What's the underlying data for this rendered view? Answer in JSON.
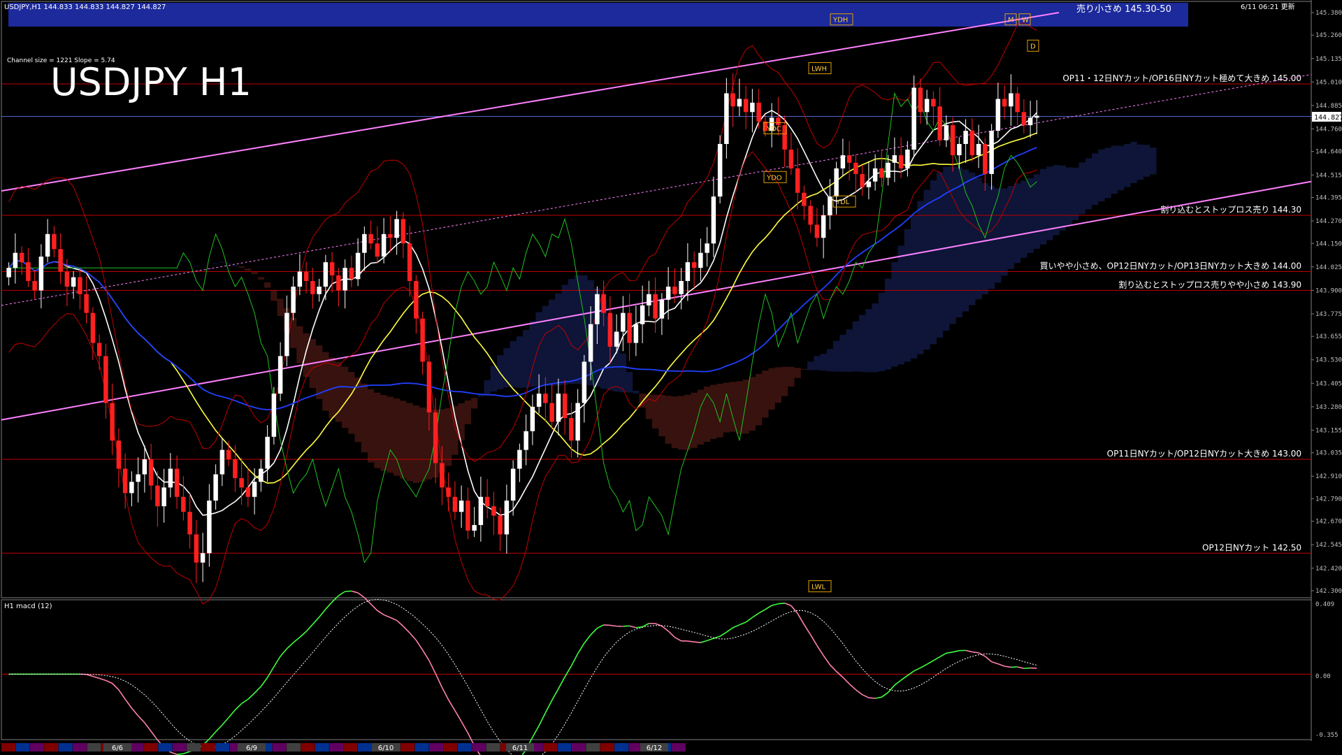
{
  "header": {
    "symbol_info": "USDJPY,H1  144.833 144.833 144.827 144.827",
    "server_time": "6/11 06:21 更新",
    "channel_info": "Channel size = 1221 Slope = 5.74",
    "big_title": "USDJPY H1",
    "top_banner": "売り小さめ 145.30-50"
  },
  "colors": {
    "background": "#000000",
    "bull_candle": "#ffffff",
    "bear_candle": "#ff2020",
    "channel": "#ff80ff",
    "grid_label": "#c0c0c0",
    "level_line": "#c00000",
    "banner": "#1c2a9c",
    "macd_up": "#40ff40",
    "macd_down": "#ff80b0",
    "cloud_up": "#4060ff",
    "cloud_down": "#ff5040"
  },
  "chart_data": {
    "type": "line",
    "ylim": [
      142.3,
      145.38
    ],
    "yticks": [
      "145.380",
      "145.260",
      "145.135",
      "145.010",
      "144.885",
      "144.760",
      "144.640",
      "144.515",
      "144.395",
      "144.270",
      "144.150",
      "144.025",
      "143.900",
      "143.775",
      "143.655",
      "143.530",
      "143.405",
      "143.280",
      "143.155",
      "143.035",
      "142.910",
      "142.790",
      "142.670",
      "142.545",
      "142.420",
      "142.300"
    ],
    "current_price": "144.827",
    "x_dates": [
      "6/6",
      "6/9",
      "6/10",
      "6/11",
      "6/12"
    ],
    "levels": [
      {
        "price": 145.0,
        "label": "OP11・12日NYカット/OP16日NYカット極めて大きめ 145.00"
      },
      {
        "price": 144.3,
        "label": "割り込むとストップロス売り 144.30"
      },
      {
        "price": 144.0,
        "label": "買いやや小さめ、OP12日NYカット/OP13日NYカット大きめ 144.00"
      },
      {
        "price": 143.9,
        "label": "割り込むとストップロス売りやや小さめ 143.90"
      },
      {
        "price": 143.0,
        "label": "OP11日NYカット/OP12日NYカット大きめ 143.00"
      },
      {
        "price": 142.5,
        "label": "OP12日NYカット 142.50"
      }
    ],
    "markers": [
      "YDH",
      "YDC",
      "YDO",
      "YDL",
      "LWH",
      "LWL",
      "M",
      "W",
      "D"
    ],
    "close": [
      144.02,
      144.1,
      144.05,
      143.95,
      143.9,
      144.08,
      144.2,
      144.12,
      144.0,
      143.92,
      143.97,
      143.88,
      143.78,
      143.62,
      143.55,
      143.3,
      143.1,
      142.95,
      142.82,
      142.88,
      142.92,
      143.0,
      142.86,
      142.75,
      142.85,
      142.95,
      142.8,
      142.72,
      142.6,
      142.45,
      142.5,
      142.78,
      142.92,
      143.05,
      143.0,
      142.9,
      142.85,
      142.8,
      142.88,
      142.95,
      143.12,
      143.35,
      143.55,
      143.78,
      143.92,
      144.0,
      143.95,
      143.88,
      143.92,
      144.05,
      143.98,
      143.9,
      144.02,
      143.96,
      144.1,
      144.2,
      144.15,
      144.08,
      144.2,
      144.18,
      144.28,
      144.15,
      143.95,
      143.75,
      143.52,
      143.25,
      142.98,
      142.85,
      142.8,
      142.72,
      142.78,
      142.62,
      142.65,
      142.8,
      142.75,
      142.7,
      142.6,
      142.78,
      142.95,
      143.05,
      143.15,
      143.28,
      143.35,
      143.3,
      143.2,
      143.35,
      143.22,
      143.1,
      143.3,
      143.52,
      143.72,
      143.88,
      143.78,
      143.6,
      143.68,
      143.78,
      143.62,
      143.72,
      143.82,
      143.88,
      143.75,
      143.85,
      143.92,
      143.88,
      143.95,
      144.05,
      144.02,
      144.1,
      144.15,
      144.4,
      144.68,
      144.95,
      144.88,
      144.92,
      144.85,
      144.9,
      144.8,
      144.75,
      144.82,
      144.78,
      144.65,
      144.55,
      144.42,
      144.35,
      144.25,
      144.18,
      144.3,
      144.4,
      144.55,
      144.62,
      144.58,
      144.52,
      144.45,
      144.48,
      144.55,
      144.5,
      144.58,
      144.62,
      144.55,
      144.65,
      144.98,
      144.85,
      144.92,
      144.88,
      144.7,
      144.78,
      144.62,
      144.68,
      144.75,
      144.62,
      144.68,
      144.52,
      144.75,
      144.92,
      144.88,
      144.95,
      144.85,
      144.78,
      144.82,
      144.83
    ]
  },
  "macd": {
    "label": "H1  macd (12)",
    "yticks": [
      "0.409",
      "0.00",
      "-0.355"
    ]
  }
}
